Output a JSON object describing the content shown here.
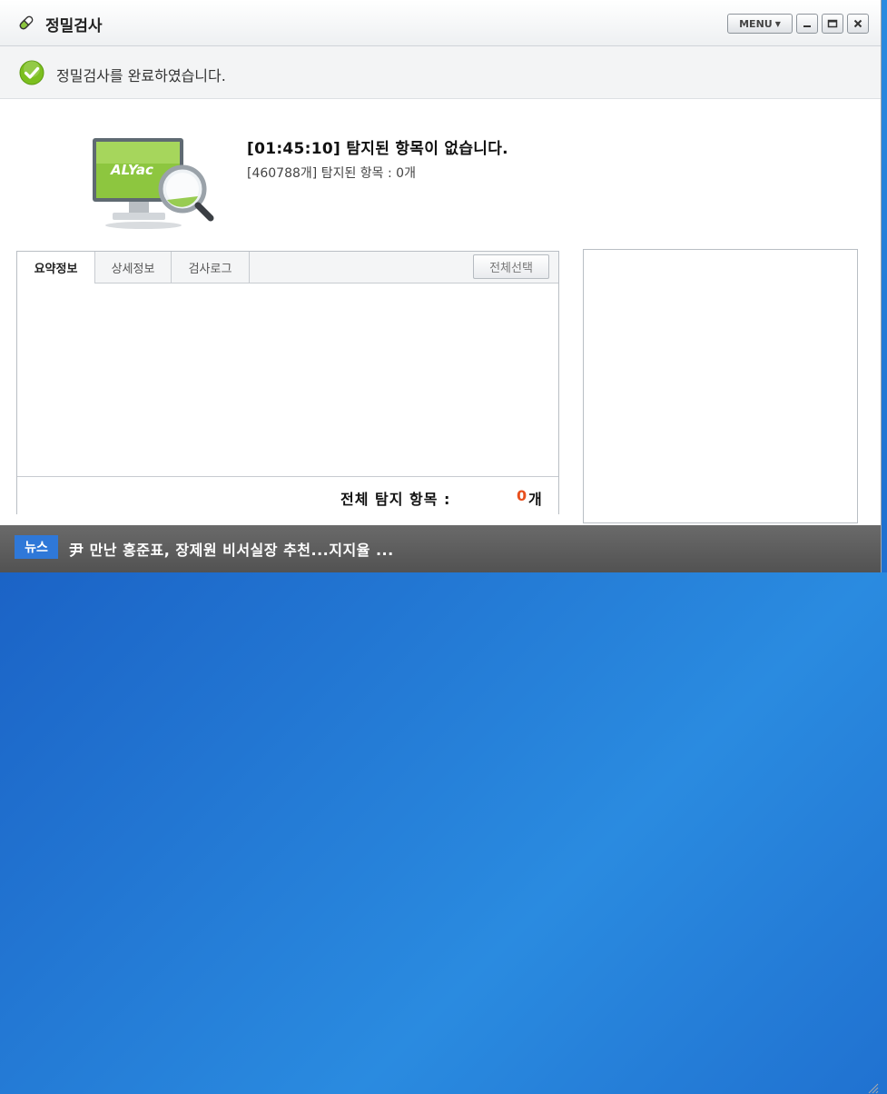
{
  "window": {
    "title": "정밀검사",
    "menu_label": "MENU",
    "min_icon": "minimize-icon",
    "max_icon": "maximize-icon",
    "close_icon": "close-icon"
  },
  "status": {
    "icon": "check-circle-icon",
    "message": "정밀검사를 완료하였습니다."
  },
  "result": {
    "image_label": "ALYac",
    "title": "[01:45:10]  탐지된 항목이 없습니다.",
    "subtitle": "[460788개] 탐지된 항목 : 0개"
  },
  "tabs": [
    {
      "label": "요약정보",
      "active": true
    },
    {
      "label": "상세정보",
      "active": false
    },
    {
      "label": "검사로그",
      "active": false
    }
  ],
  "select_all_label": "전체선택",
  "summary": {
    "label": "전체 탐지 항목 :",
    "count": "0",
    "unit": "개"
  },
  "news": {
    "badge": "뉴스",
    "headline": "尹 만난 홍준표, 장제원 비서실장 추천...지지율 ..."
  },
  "colors": {
    "accent": "#2f78d8",
    "count": "#e8501e",
    "check": "#7cbf1f"
  }
}
